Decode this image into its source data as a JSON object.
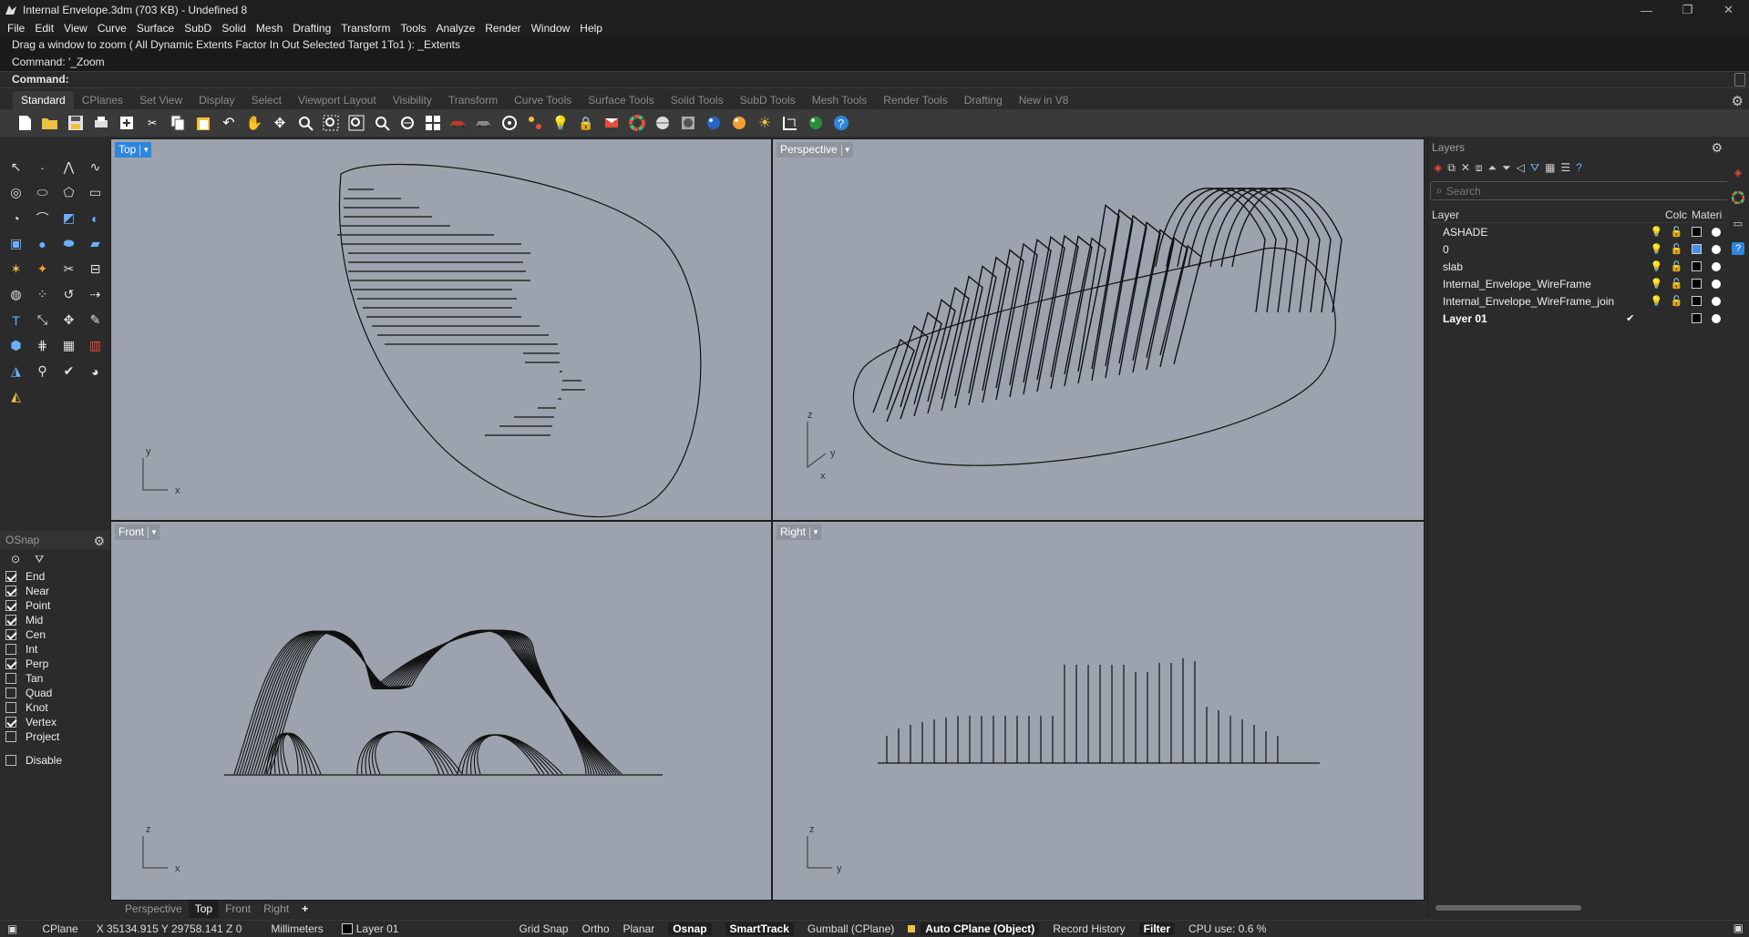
{
  "window": {
    "title": "Internal Envelope.3dm (703 KB) - Undefined 8",
    "controls": [
      "—",
      "❐",
      "✕"
    ]
  },
  "menu": [
    "File",
    "Edit",
    "View",
    "Curve",
    "Surface",
    "SubD",
    "Solid",
    "Mesh",
    "Drafting",
    "Transform",
    "Tools",
    "Analyze",
    "Render",
    "Window",
    "Help"
  ],
  "command": {
    "history": [
      "Drag a window to zoom ( All  Dynamic  Extents  Factor  In  Out  Selected  Target  1To1 ): _Extents",
      "Command: '_Zoom"
    ],
    "prompt": "Command:",
    "value": ""
  },
  "toolbar_tabs": [
    "Standard",
    "CPlanes",
    "Set View",
    "Display",
    "Select",
    "Viewport Layout",
    "Visibility",
    "Transform",
    "Curve Tools",
    "Surface Tools",
    "Solid Tools",
    "SubD Tools",
    "Mesh Tools",
    "Render Tools",
    "Drafting",
    "New in V8"
  ],
  "toolbar_tab_active": "Standard",
  "toolbar_icons": [
    "new-icon",
    "open-icon",
    "save-icon",
    "print-icon",
    "import-icon",
    "cut-icon",
    "copy-icon",
    "paste-icon",
    "undo-icon",
    "pan-icon",
    "rotate-view-icon",
    "zoom-icon",
    "zoom-window-icon",
    "zoom-extents-icon",
    "zoom-selected-icon",
    "zoom-extents-all-icon",
    "four-view-icon",
    "car-icon",
    "shaded-car-icon",
    "cplane-icon",
    "grid-snap-icon",
    "light-icon",
    "lock-icon",
    "render-mode-icon",
    "color-wheel-icon",
    "sphere-icon",
    "texture-icon",
    "render-sphere-icon",
    "material-sphere-icon",
    "sun-icon",
    "dimension-icon",
    "environment-icon",
    "help-icon"
  ],
  "viewports": {
    "top": {
      "label": "Top",
      "axis_a": "y",
      "axis_b": "x"
    },
    "perspective": {
      "label": "Perspective",
      "axis_a": "z",
      "axis_b": "y",
      "axis_c": "x"
    },
    "front": {
      "label": "Front",
      "axis_a": "z",
      "axis_b": "x"
    },
    "right": {
      "label": "Right",
      "axis_a": "z",
      "axis_b": "y"
    }
  },
  "viewport_tabs": [
    "Perspective",
    "Top",
    "Front",
    "Right",
    "+"
  ],
  "viewport_tab_active": "Top",
  "osnap": {
    "title": "OSnap",
    "items": [
      {
        "label": "End",
        "checked": true
      },
      {
        "label": "Near",
        "checked": true
      },
      {
        "label": "Point",
        "checked": true
      },
      {
        "label": "Mid",
        "checked": true
      },
      {
        "label": "Cen",
        "checked": true
      },
      {
        "label": "Int",
        "checked": false
      },
      {
        "label": "Perp",
        "checked": true
      },
      {
        "label": "Tan",
        "checked": false
      },
      {
        "label": "Quad",
        "checked": false
      },
      {
        "label": "Knot",
        "checked": false
      },
      {
        "label": "Vertex",
        "checked": true
      },
      {
        "label": "Project",
        "checked": false
      }
    ],
    "disable": {
      "label": "Disable",
      "checked": false
    }
  },
  "layers": {
    "title": "Layers",
    "search_placeholder": "Search",
    "columns": {
      "layer": "Layer",
      "color": "Colc",
      "material": "Materi"
    },
    "rows": [
      {
        "name": "ASHADE",
        "current": false,
        "color": "#000000"
      },
      {
        "name": "0",
        "current": false,
        "color": "#4a90e2"
      },
      {
        "name": "slab",
        "current": false,
        "color": "#000000"
      },
      {
        "name": "Internal_Envelope_WireFrame",
        "current": false,
        "color": "#000000"
      },
      {
        "name": "Internal_Envelope_WireFrame_join",
        "current": false,
        "color": "#000000"
      },
      {
        "name": "Layer 01",
        "current": true,
        "color": "#000000"
      }
    ]
  },
  "status": {
    "cplane": "CPlane",
    "coords": "X 35134.915 Y 29758.141 Z 0",
    "units": "Millimeters",
    "layer": "Layer 01",
    "grid_snap": "Grid Snap",
    "ortho": "Ortho",
    "planar": "Planar",
    "osnap": "Osnap",
    "smarttrack": "SmartTrack",
    "gumball": "Gumball (CPlane)",
    "auto_cplane": "Auto CPlane (Object)",
    "record_history": "Record History",
    "filter": "Filter",
    "cpu": "CPU use: 0.6 %"
  },
  "colors": {
    "viewport_bg": "#9ca3ae",
    "active_label": "#2e86de",
    "ui_dark": "#2b2b2b"
  }
}
